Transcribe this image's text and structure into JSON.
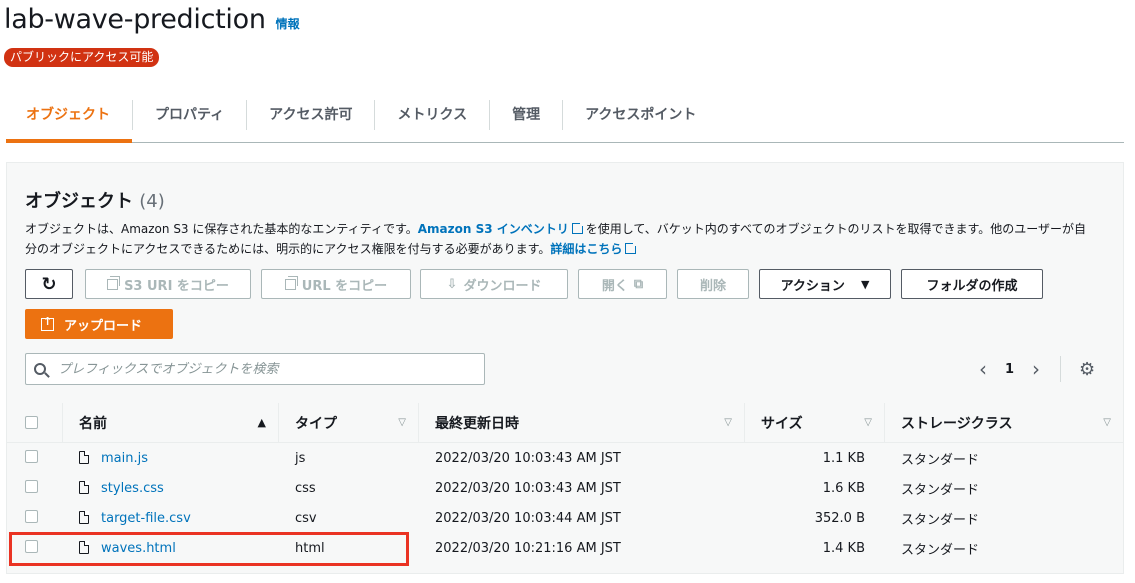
{
  "bucket": {
    "name": "lab-wave-prediction",
    "info_label": "情報",
    "access_badge": "パブリックにアクセス可能"
  },
  "tabs": [
    {
      "label": "オブジェクト",
      "active": true
    },
    {
      "label": "プロパティ",
      "active": false
    },
    {
      "label": "アクセス許可",
      "active": false
    },
    {
      "label": "メトリクス",
      "active": false
    },
    {
      "label": "管理",
      "active": false
    },
    {
      "label": "アクセスポイント",
      "active": false
    }
  ],
  "objects_panel": {
    "title": "オブジェクト",
    "count": "(4)",
    "desc_part1": "オブジェクトは、Amazon S3 に保存された基本的なエンティティです。",
    "desc_link1": "Amazon S3 インベントリ",
    "desc_part2": "を使用して、バケット内のすべてのオブジェクトのリストを取得できます。他のユーザーが自分のオブジェクトにアクセスできるためには、明示的にアクセス権限を付与する必要があります。",
    "desc_link2": "詳細はこちら"
  },
  "toolbar": {
    "copy_s3_uri": "S3 URI をコピー",
    "copy_url": "URL をコピー",
    "download": "ダウンロード",
    "open": "開く",
    "delete": "削除",
    "actions": "アクション",
    "create_folder": "フォルダの作成",
    "upload": "アップロード"
  },
  "search": {
    "placeholder": "プレフィックスでオブジェクトを検索"
  },
  "pagination": {
    "current_page": "1"
  },
  "table": {
    "headers": {
      "name": "名前",
      "type": "タイプ",
      "modified": "最終更新日時",
      "size": "サイズ",
      "storage_class": "ストレージクラス"
    },
    "rows": [
      {
        "name": "main.js",
        "type": "js",
        "modified": "2022/03/20 10:03:43 AM JST",
        "size": "1.1 KB",
        "storage_class": "スタンダード"
      },
      {
        "name": "styles.css",
        "type": "css",
        "modified": "2022/03/20 10:03:43 AM JST",
        "size": "1.6 KB",
        "storage_class": "スタンダード"
      },
      {
        "name": "target-file.csv",
        "type": "csv",
        "modified": "2022/03/20 10:03:44 AM JST",
        "size": "352.0 B",
        "storage_class": "スタンダード"
      },
      {
        "name": "waves.html",
        "type": "html",
        "modified": "2022/03/20 10:21:16 AM JST",
        "size": "1.4 KB",
        "storage_class": "スタンダード"
      }
    ]
  },
  "colors": {
    "accent": "#ec7211",
    "link": "#0073bb",
    "badge": "#d13212",
    "highlight": "#ea3323"
  }
}
